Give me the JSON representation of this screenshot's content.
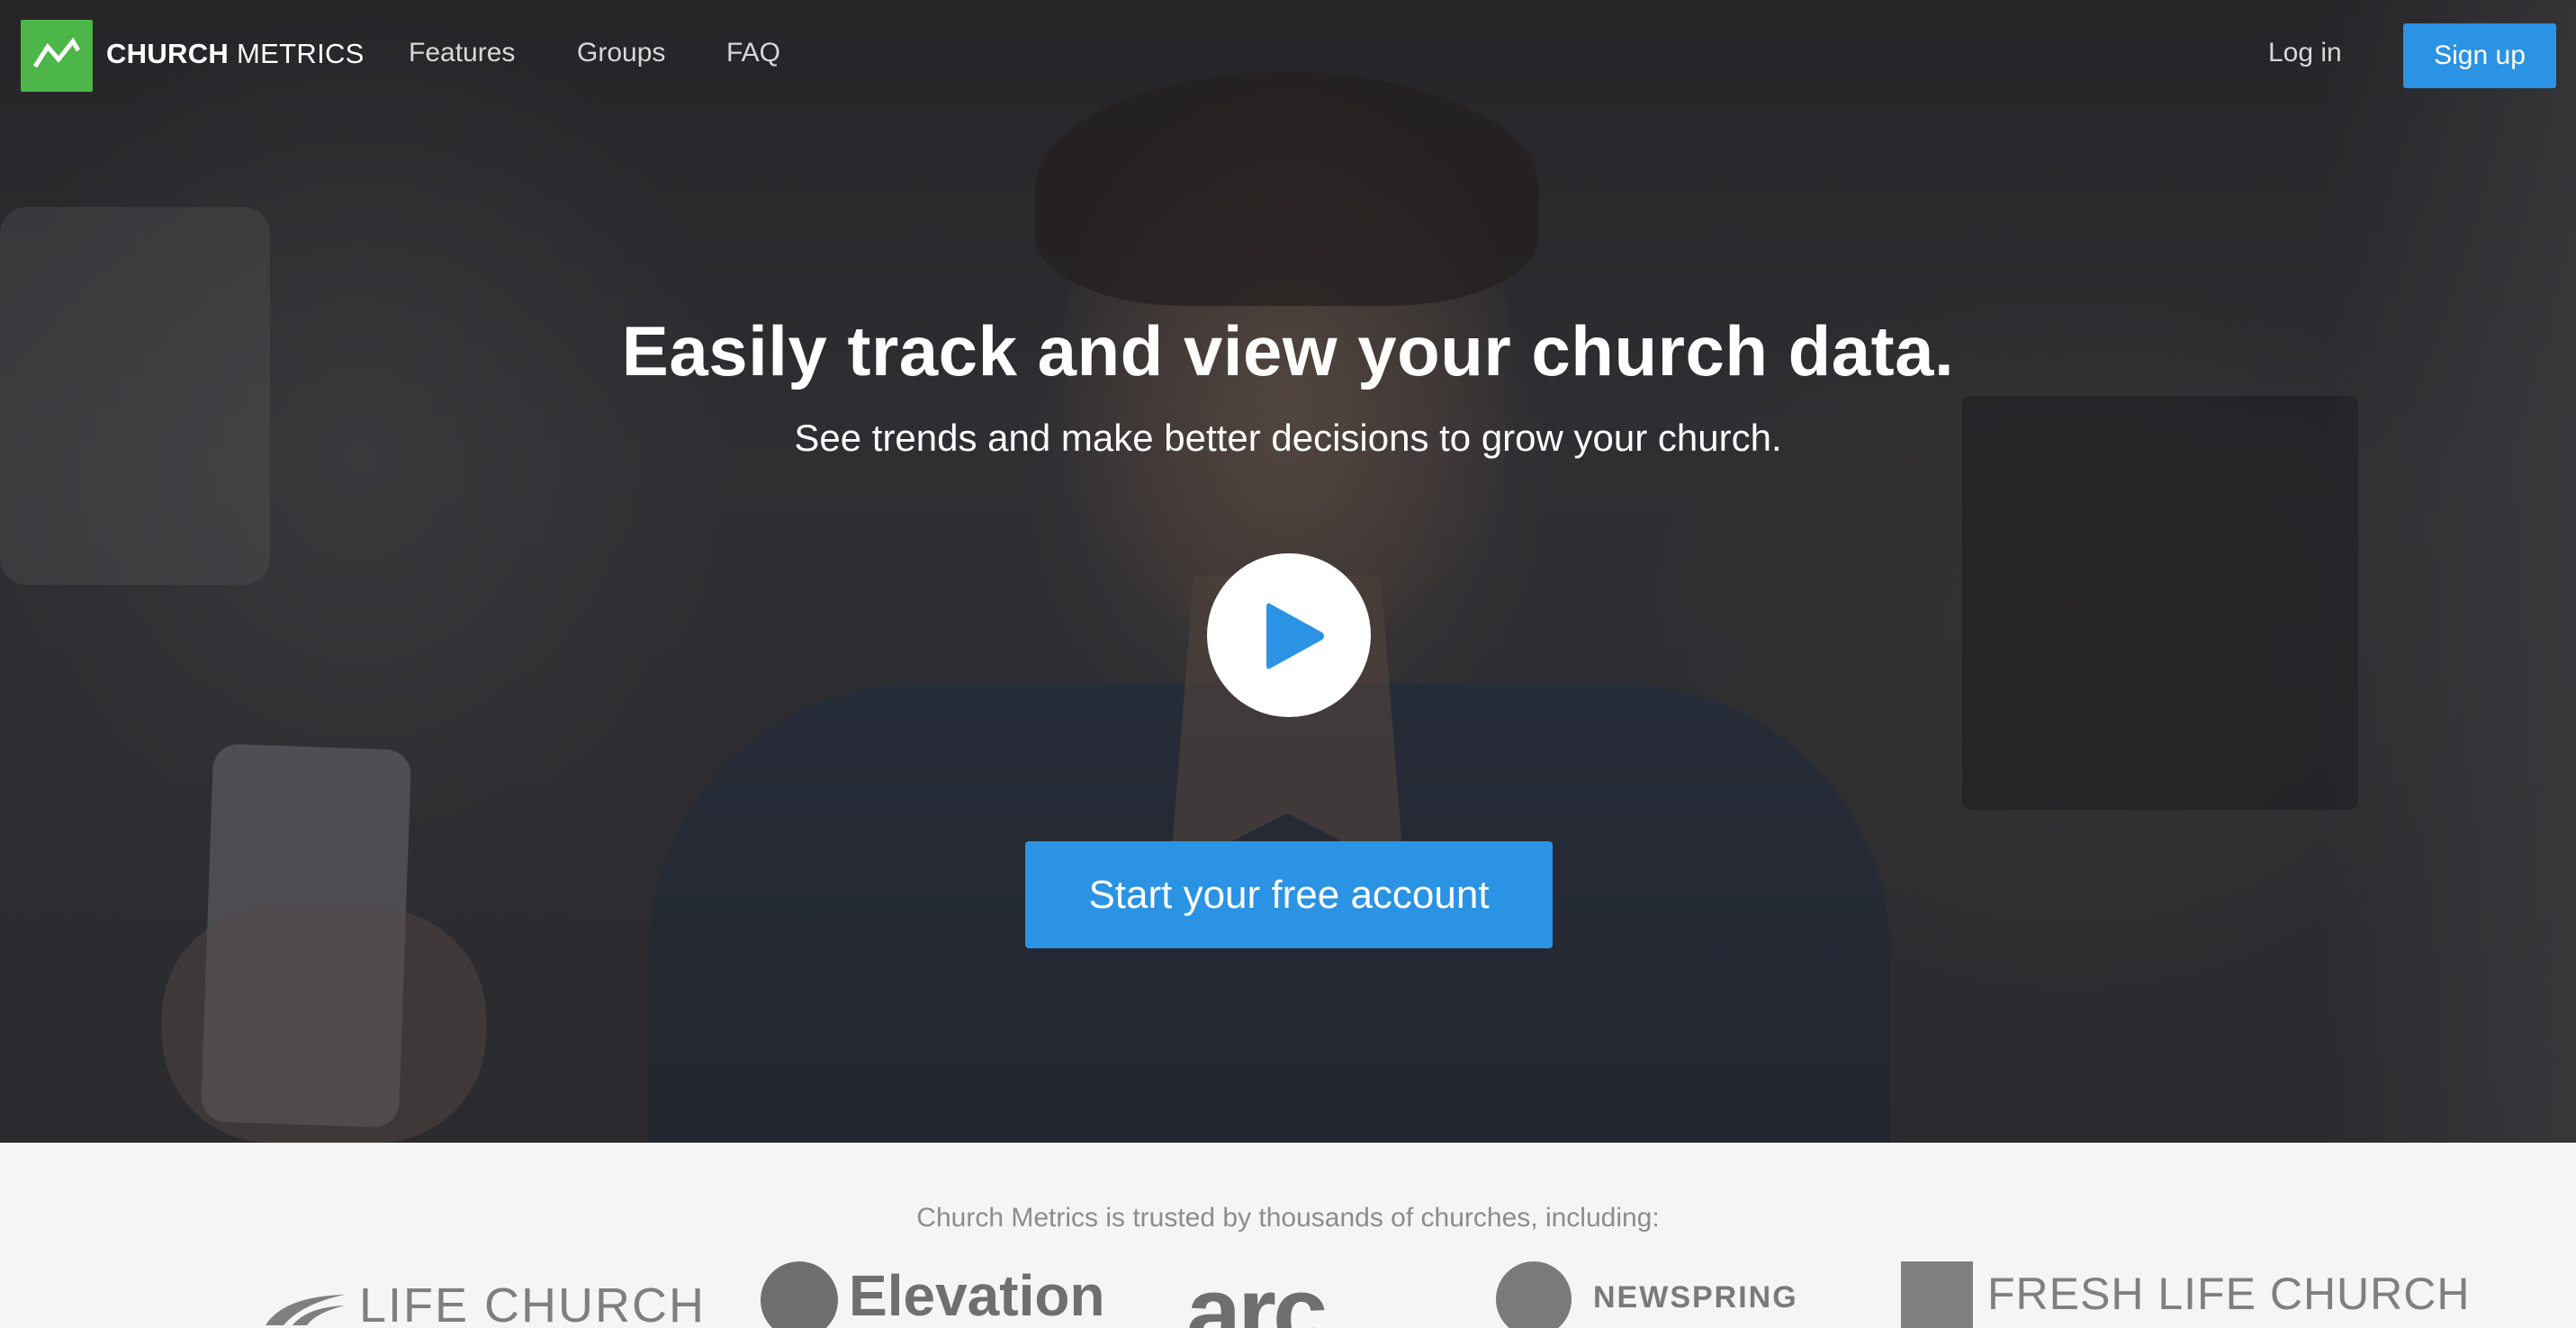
{
  "nav": {
    "brand_bold": "CHURCH",
    "brand_light": "METRICS",
    "links": [
      "Features",
      "Groups",
      "FAQ"
    ],
    "login_label": "Log in",
    "signup_label": "Sign up",
    "logo_icon": "line-chart-icon"
  },
  "hero": {
    "headline": "Easily track and view your church data.",
    "subheadline": "See trends and make better decisions to grow your church.",
    "play_icon": "play-icon",
    "cta_label": "Start your free account"
  },
  "trusted": {
    "text": "Church Metrics is trusted by thousands of churches, including:",
    "logos": [
      "LIFE CHURCH",
      "Elevation",
      "arc",
      "NEWSPRING",
      "FRESH LIFE CHURCH"
    ]
  },
  "colors": {
    "brand_green": "#4cb648",
    "accent_blue": "#2b93e4",
    "light_section_bg": "#f5f5f5",
    "muted_text": "#8c8c8c"
  }
}
